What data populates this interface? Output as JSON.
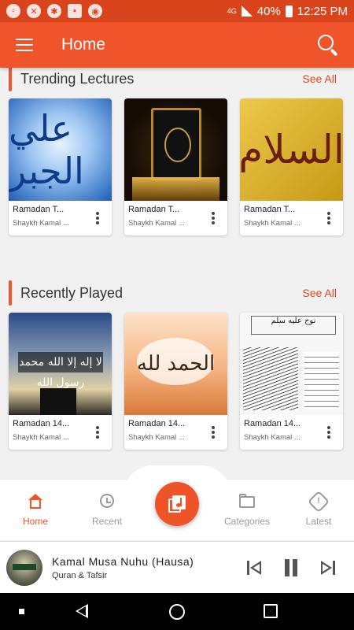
{
  "status_bar": {
    "network": "4G",
    "battery": "40%",
    "time": "12:25 PM"
  },
  "app_bar": {
    "title": "Home"
  },
  "sections": {
    "trending": {
      "title": "Trending Lectures",
      "see_all": "See All",
      "cards": [
        {
          "title": "Ramadan T...",
          "subtitle": "Shaykh Kamal ...",
          "art_text": "علي الجبر"
        },
        {
          "title": "Ramadan T...",
          "subtitle": "Shaykh Kamal ...",
          "art_text": ""
        },
        {
          "title": "Ramadan T...",
          "subtitle": "Shaykh Kamal ...",
          "art_text": "السلام"
        }
      ]
    },
    "recent": {
      "title": "Recently Played",
      "see_all": "See All",
      "cards": [
        {
          "title": "Ramadan 14...",
          "subtitle": "Shaykh Kamal ...",
          "art_text": "لا إله إلا الله محمد رسول الله"
        },
        {
          "title": "Ramadan 14...",
          "subtitle": "Shaykh Kamal ...",
          "art_text": "الحمد لله"
        },
        {
          "title": "Ramadan 14...",
          "subtitle": "Shaykh Kamal ...",
          "art_text": "نوح عليه سلم"
        }
      ]
    }
  },
  "bottom_nav": {
    "home": "Home",
    "recent": "Recent",
    "categories": "Categories",
    "latest": "Latest"
  },
  "player": {
    "title": "Kamal Musa Nuhu (Hausa)",
    "subtitle": "Quran & Tafsir"
  },
  "colors": {
    "primary": "#f0542a",
    "status_bar": "#d9441d",
    "accent_text": "#e0451b"
  }
}
